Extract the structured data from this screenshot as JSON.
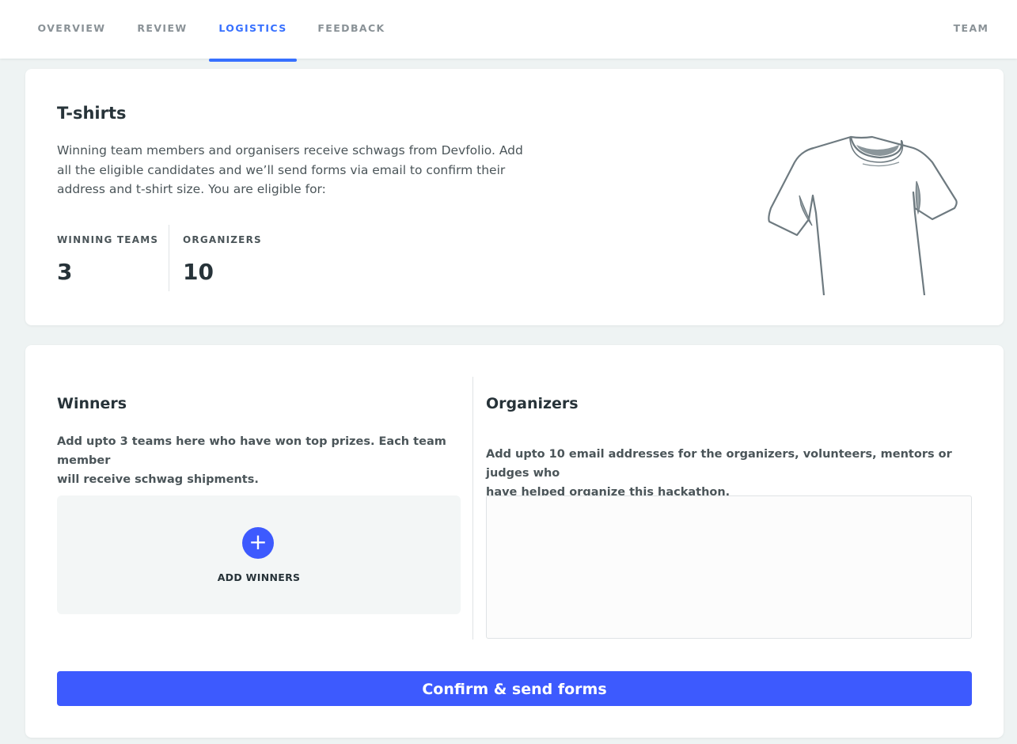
{
  "nav": {
    "tabs": [
      {
        "label": "OVERVIEW",
        "active": false
      },
      {
        "label": "REVIEW",
        "active": false
      },
      {
        "label": "LOGISTICS",
        "active": true
      },
      {
        "label": "FEEDBACK",
        "active": false
      }
    ],
    "team_label": "TEAM"
  },
  "tshirts": {
    "title": "T-shirts",
    "description_lines": [
      "Winning team members and organisers receive schwags from Devfolio. Add",
      "all the eligible candidates and we’ll send forms via email to confirm their",
      "address and t-shirt size. You are eligible for:"
    ],
    "stats": [
      {
        "label": "WINNING TEAMS",
        "value": "3"
      },
      {
        "label": "ORGANIZERS",
        "value": "10"
      }
    ],
    "illustration_icon": "tshirt-icon"
  },
  "winners": {
    "title": "Winners",
    "description_lines": [
      "Add upto 3 teams here who have won top prizes. Each team member",
      "will receive schwag shipments."
    ],
    "add_button_icon": "plus",
    "add_button_label": "ADD WINNERS"
  },
  "organizers": {
    "title": "Organizers",
    "description_lines": [
      "Add upto 10 email addresses for the organizers, volunteers, mentors or judges who",
      "have helped organize this hackathon."
    ],
    "emails_value": ""
  },
  "confirm_button_label": "Confirm & send forms",
  "colors": {
    "accent": "#3d5afe",
    "tab_active": "#3770ff",
    "background": "#eef3f3"
  }
}
